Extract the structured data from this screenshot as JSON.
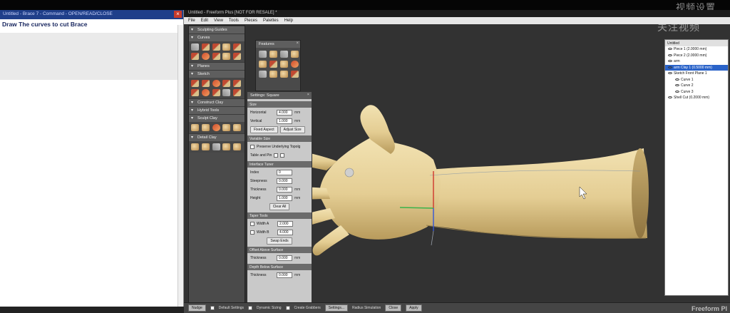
{
  "watermark_top": "视频设置",
  "watermark_mid": "关注视频",
  "watermark_brand": "Freeform Pl",
  "doc_window": {
    "title": "Untitled - Brace 7 - Command - OPEN/READ/CLOSE",
    "heading": "Draw The curves to cut Brace",
    "close_icon": "×"
  },
  "app": {
    "title": "Untitled - Freeform Plus [NOT FOR RESALE] *",
    "menu": [
      "File",
      "Edit",
      "View",
      "Tools",
      "Pieces",
      "Palettes",
      "Help"
    ]
  },
  "palette": {
    "sections": [
      "Sculpting Guides",
      "Curves",
      "Planes",
      "Sketch",
      "Construct Clay",
      "Hybrid Tools",
      "Sculpt Clay",
      "Detail Clay"
    ]
  },
  "features": {
    "title": "Features",
    "close": "×"
  },
  "settings": {
    "title": "Settings: Square",
    "close": "×",
    "size_section": "Size",
    "horizontal_label": "Horizontal",
    "horizontal_value": "4.000",
    "vertical_label": "Vertical",
    "vertical_value": "1.000",
    "unit": "mm",
    "fixed_aspect": "Fixed Aspect",
    "adjust_size": "Adjust Size",
    "variable_size": "Variable Size",
    "variable_option": "Preserve Underlying Topolg",
    "table_row": "Table and Pin",
    "interface_tuner": "Interface Tuner",
    "index_label": "Index",
    "index_value": "0",
    "steepness_label": "Steepness",
    "steepness_value": "0.000",
    "thickness_label": "Thickness",
    "thickness_value": "0.000",
    "height_label": "Height",
    "height_value": "1.000",
    "clear_all": "Clear All",
    "taper_tools": "Taper Tools",
    "width1_label": "Width A",
    "width1_value": "2.000",
    "width2_label": "Width B",
    "width2_value": "4.000",
    "swap_btn": "Swap Ends",
    "offset_section": "Offset Above Surface",
    "offset_label": "Thickness",
    "offset_value": "0.000",
    "depth_section": "Depth Below Surface",
    "depth_label": "Thickness",
    "depth_value": "0.000"
  },
  "scene": {
    "root": "Untitled",
    "rows": [
      {
        "label": "Piece 1 (2.0000 mm)",
        "sel": false
      },
      {
        "label": "Piece 2 (2.0000 mm)",
        "sel": false
      },
      {
        "label": "arm",
        "sel": false
      },
      {
        "label": "arm Clay 1 (0.5000 mm)",
        "sel": true
      },
      {
        "label": "Sketch Front Plane 1",
        "sel": false
      },
      {
        "label": "Curve 1",
        "sel": false
      },
      {
        "label": "Curve 2",
        "sel": false
      },
      {
        "label": "Curve 3",
        "sel": false
      },
      {
        "label": "Shell Cut (0.2000 mm)",
        "sel": false
      }
    ]
  },
  "bottom": {
    "nudge": "Nudge",
    "default_settings": "Default Settings",
    "dynamic_sizing": "Dynamic Sizing",
    "create_grabbers": "Create Grabbers",
    "settings_btn": "Settings...",
    "radius": "Radius Simulation",
    "close_btn": "Close",
    "apply_btn": "Apply"
  },
  "colors": {
    "skin": "#e6d19b",
    "selection": "#2a63c9",
    "title_blue": "#1f3f8a"
  }
}
